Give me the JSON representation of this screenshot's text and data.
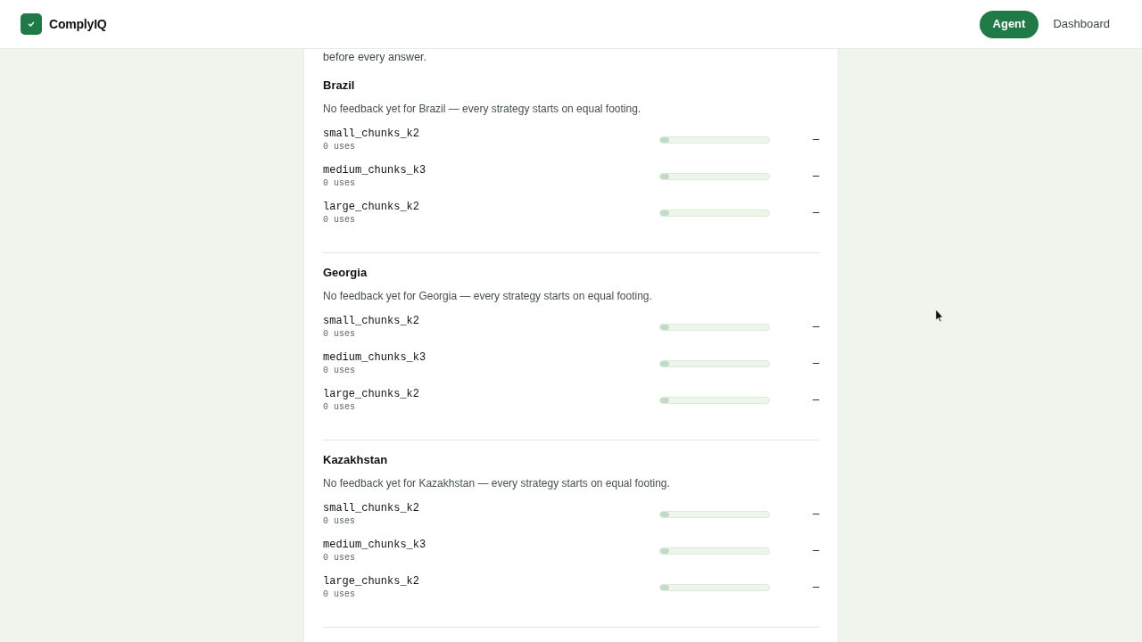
{
  "header": {
    "brand": "ComplyIQ",
    "nav": [
      {
        "label": "Agent",
        "selected": true
      },
      {
        "label": "Dashboard",
        "selected": false
      }
    ]
  },
  "panel": {
    "intro_tail": "before every answer.",
    "countries": [
      {
        "name": "Brazil",
        "note": "No feedback yet for Brazil — every strategy starts on equal footing.",
        "strategies": [
          {
            "name": "small_chunks_k2",
            "uses": "0 uses",
            "level": 0.08,
            "score": "—"
          },
          {
            "name": "medium_chunks_k3",
            "uses": "0 uses",
            "level": 0.08,
            "score": "—"
          },
          {
            "name": "large_chunks_k2",
            "uses": "0 uses",
            "level": 0.08,
            "score": "—"
          }
        ]
      },
      {
        "name": "Georgia",
        "note": "No feedback yet for Georgia — every strategy starts on equal footing.",
        "strategies": [
          {
            "name": "small_chunks_k2",
            "uses": "0 uses",
            "level": 0.08,
            "score": "—"
          },
          {
            "name": "medium_chunks_k3",
            "uses": "0 uses",
            "level": 0.08,
            "score": "—"
          },
          {
            "name": "large_chunks_k2",
            "uses": "0 uses",
            "level": 0.08,
            "score": "—"
          }
        ]
      },
      {
        "name": "Kazakhstan",
        "note": "No feedback yet for Kazakhstan — every strategy starts on equal footing.",
        "strategies": [
          {
            "name": "small_chunks_k2",
            "uses": "0 uses",
            "level": 0.08,
            "score": "—"
          },
          {
            "name": "medium_chunks_k3",
            "uses": "0 uses",
            "level": 0.08,
            "score": "—"
          },
          {
            "name": "large_chunks_k2",
            "uses": "0 uses",
            "level": 0.08,
            "score": "—"
          }
        ]
      }
    ]
  }
}
